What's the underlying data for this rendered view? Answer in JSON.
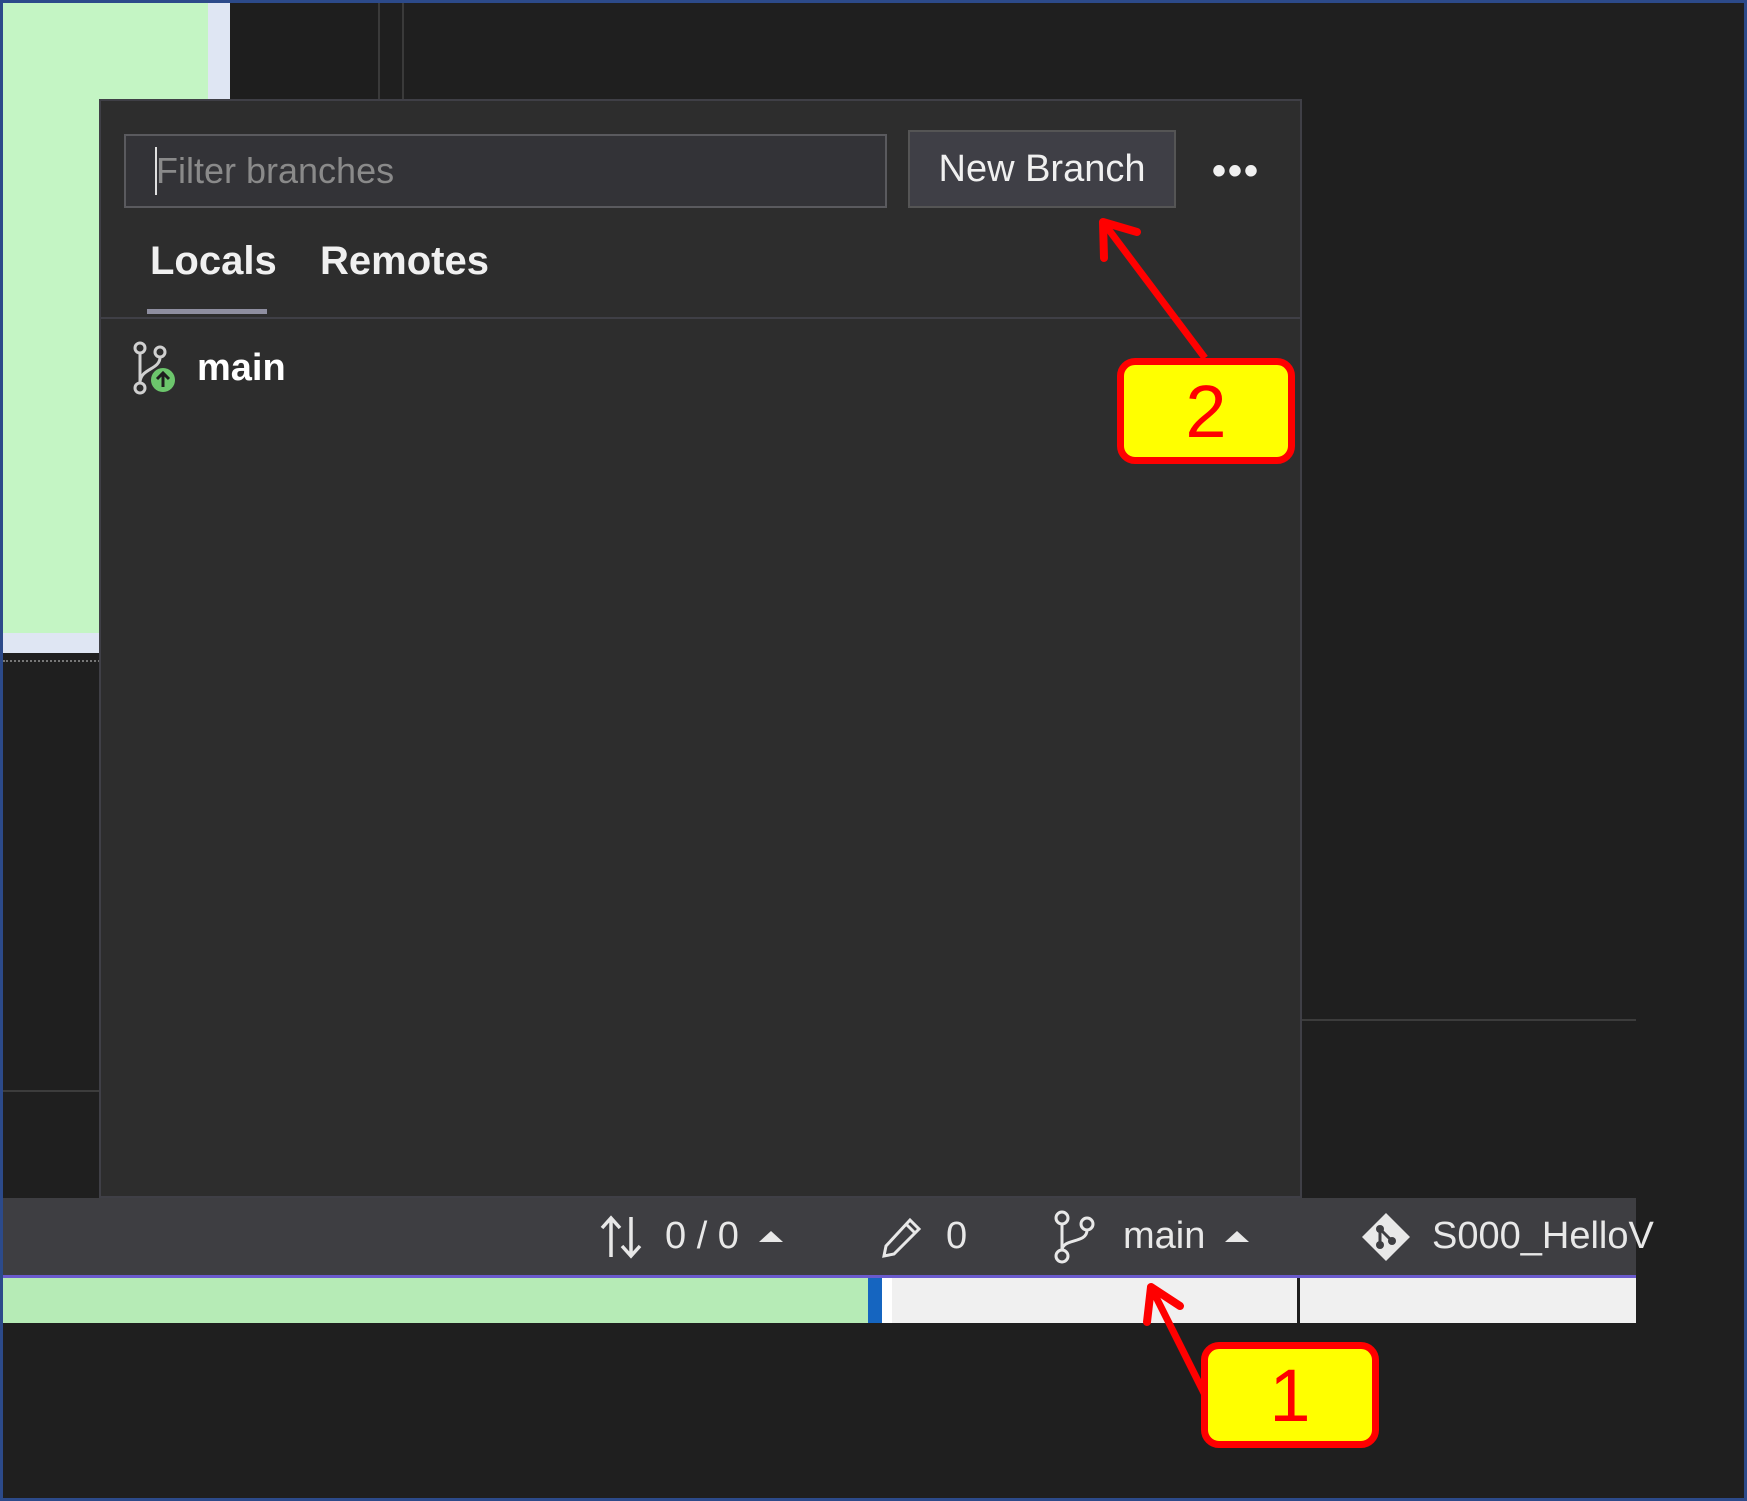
{
  "branch_popup": {
    "filter": {
      "placeholder": "Filter branches",
      "value": ""
    },
    "new_branch_label": "New Branch",
    "more_label": "•••",
    "tabs": [
      {
        "label": "Locals",
        "selected": true
      },
      {
        "label": "Remotes",
        "selected": false
      }
    ],
    "branches": [
      {
        "name": "main",
        "icon": "branch-publish-icon"
      }
    ]
  },
  "status_bar": {
    "sync": {
      "icon": "sync-arrows-icon",
      "text": "0 / 0"
    },
    "changes": {
      "icon": "pencil-icon",
      "text": "0"
    },
    "branch": {
      "icon": "git-branch-icon",
      "text": "main"
    },
    "repo": {
      "icon": "git-repo-icon",
      "text": "S000_HelloV"
    }
  },
  "annotations": {
    "callout_1": "1",
    "callout_2": "2",
    "color": "#ff0000",
    "fill": "#ffff00"
  }
}
